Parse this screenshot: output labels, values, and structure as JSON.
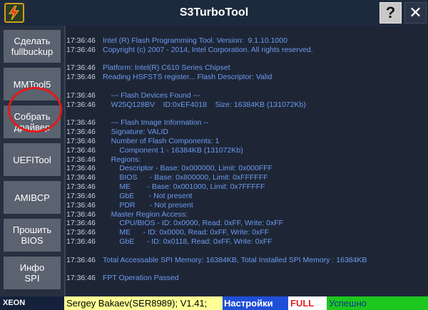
{
  "window": {
    "title": "S3TurboTool",
    "help_label": "?",
    "close_label": "✕",
    "icon": "lightning-bolt-icon"
  },
  "sidebar": {
    "items": [
      {
        "label": "Сделать\nfullbuckup"
      },
      {
        "label": "MMTool5"
      },
      {
        "label": "Собрать\nдрайвер"
      },
      {
        "label": "UEFITool"
      },
      {
        "label": "AMIBCP"
      },
      {
        "label": "Прошить\nBIOS"
      },
      {
        "label": "Инфо\nSPI"
      }
    ]
  },
  "log": [
    {
      "time": "17:36:46",
      "msg": "Intel (R) Flash Programming Tool. Version:  9.1.10.1000"
    },
    {
      "time": "17:36:46",
      "msg": "Copyright (c) 2007 - 2014, Intel Corporation. All rights reserved."
    },
    {
      "time": "",
      "msg": ""
    },
    {
      "time": "17:36:46",
      "msg": "Platform: Intel(R) C610 Series Chipset"
    },
    {
      "time": "17:36:46",
      "msg": "Reading HSFSTS register... Flash Descriptor: Valid"
    },
    {
      "time": "",
      "msg": ""
    },
    {
      "time": "17:36:46",
      "msg": "    --- Flash Devices Found ---"
    },
    {
      "time": "17:36:46",
      "msg": "    W25Q128BV    ID:0xEF4018    Size: 16384KB (131072Kb)"
    },
    {
      "time": "",
      "msg": ""
    },
    {
      "time": "17:36:46",
      "msg": "    --- Flash Image Information --"
    },
    {
      "time": "17:36:46",
      "msg": "    Signature: VALID"
    },
    {
      "time": "17:36:46",
      "msg": "    Number of Flash Components: 1"
    },
    {
      "time": "17:36:46",
      "msg": "        Component 1 - 16384KB (131072Kb)"
    },
    {
      "time": "17:36:46",
      "msg": "    Regions:"
    },
    {
      "time": "17:36:46",
      "msg": "        Descriptor - Base: 0x000000, Limit: 0x000FFF"
    },
    {
      "time": "17:36:46",
      "msg": "        BIOS      - Base: 0x800000, Limit: 0xFFFFFF"
    },
    {
      "time": "17:36:46",
      "msg": "        ME        - Base: 0x001000, Limit: 0x7FFFFF"
    },
    {
      "time": "17:36:46",
      "msg": "        GbE       - Not present"
    },
    {
      "time": "17:36:46",
      "msg": "        PDR       - Not present"
    },
    {
      "time": "17:36:46",
      "msg": "    Master Region Access:"
    },
    {
      "time": "17:36:46",
      "msg": "        CPU/BIOS - ID: 0x0000, Read: 0xFF, Write: 0xFF"
    },
    {
      "time": "17:36:46",
      "msg": "        ME      - ID: 0x0000, Read: 0xFF, Write: 0xFF"
    },
    {
      "time": "17:36:46",
      "msg": "        GbE      - ID: 0x0118, Read: 0xFF, Write: 0xFF"
    },
    {
      "time": "",
      "msg": ""
    },
    {
      "time": "17:36:46",
      "msg": "Total Accessable SPI Memory: 16384KB, Total Installed SPI Memory : 16384KB"
    },
    {
      "time": "",
      "msg": ""
    },
    {
      "time": "17:36:46",
      "msg": "FPT Operation Passed"
    }
  ],
  "statusbar": {
    "cpu": "XEON",
    "author": "Sergey Bakaev(SER8989); V1.41;",
    "settings": "Настройки",
    "mode": "FULL",
    "status": "Успешно"
  }
}
